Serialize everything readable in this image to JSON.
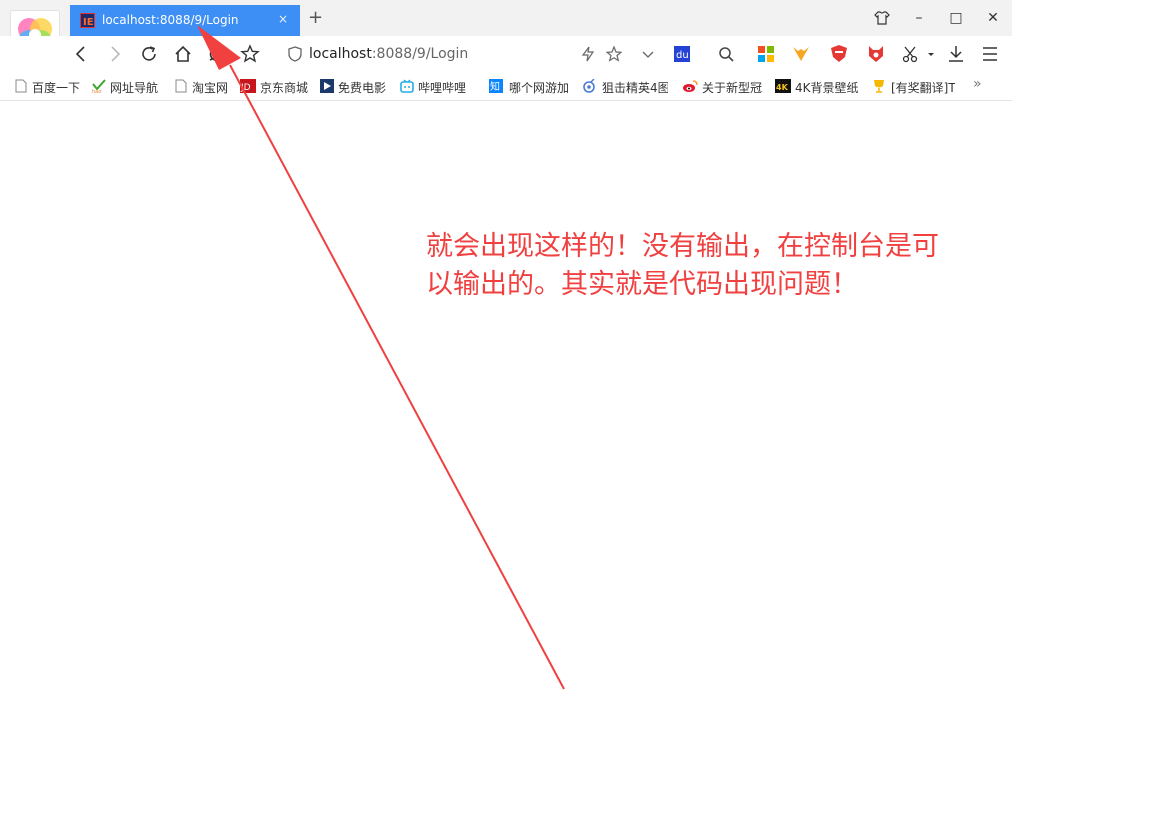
{
  "tab": {
    "title": "localhost:8088/9/Login",
    "close": "×"
  },
  "new_tab": "+",
  "window_controls": {
    "skin": "shirt-icon",
    "minimize": "–",
    "maximize": "□",
    "close": "✕"
  },
  "address_bar": {
    "host": "localhost",
    "path": ":8088/9/Login"
  },
  "bookmarks": [
    {
      "label": "百度一下",
      "icon": "page-icon"
    },
    {
      "label": "网址导航",
      "icon": "hao-icon"
    },
    {
      "label": "淘宝网",
      "icon": "page-icon"
    },
    {
      "label": "京东商城",
      "icon": "jd-icon"
    },
    {
      "label": "免费电影",
      "icon": "film-icon"
    },
    {
      "label": "哔哩哔哩",
      "icon": "bilibili-icon"
    },
    {
      "label": "哪个网游加",
      "icon": "zhi-icon"
    },
    {
      "label": "狙击精英4图",
      "icon": "target-icon"
    },
    {
      "label": "关于新型冠",
      "icon": "weibo-icon"
    },
    {
      "label": "4K背景壁纸",
      "icon": "4k-icon"
    },
    {
      "label": "[有奖翻译]T",
      "icon": "trophy-icon"
    }
  ],
  "more_bookmarks": "»",
  "annotation": {
    "line1": "就会出现这样的！没有输出，在控制台是可",
    "line2": "以输出的。其实就是代码出现问题！"
  },
  "colors": {
    "tab": "#3d8ef5",
    "annotation": "#f04040"
  }
}
